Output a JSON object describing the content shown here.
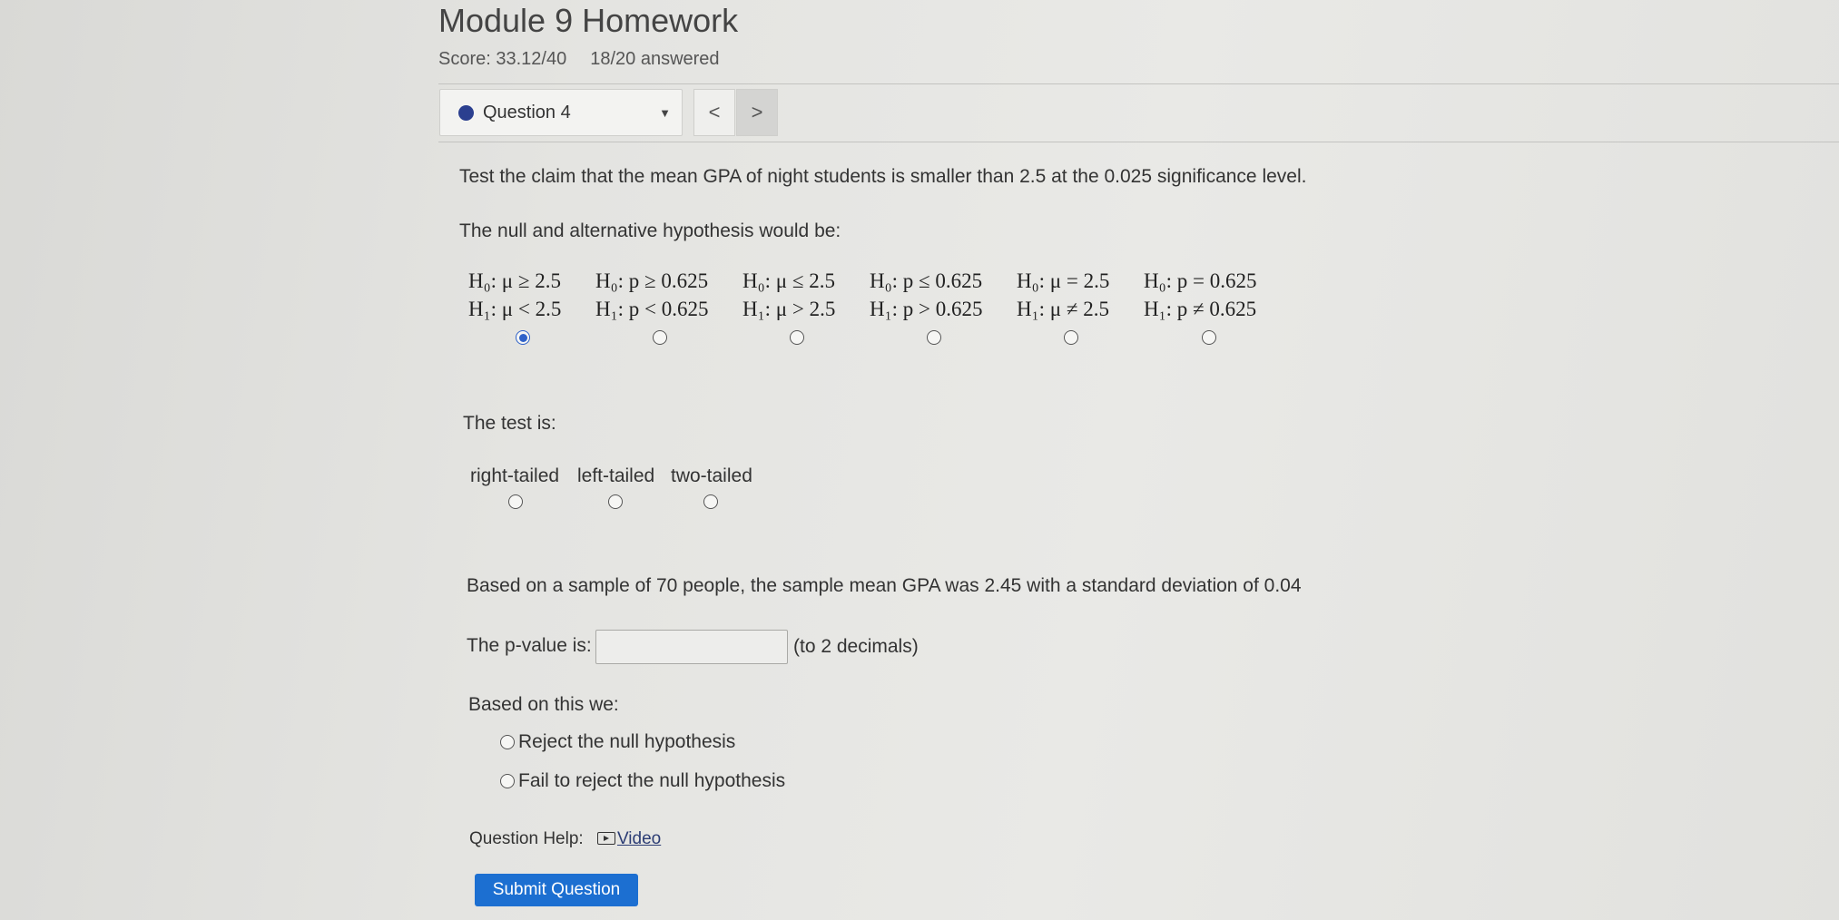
{
  "header": {
    "title": "Module 9 Homework",
    "score": "Score: 33.12/40",
    "answered": "18/20 answered"
  },
  "nav": {
    "question_select": "Question 4",
    "prev_icon": "chevron-left-icon",
    "next_icon": "chevron-right-icon",
    "prev_glyph": "<",
    "next_glyph": ">"
  },
  "question": {
    "prompt": "Test the claim that the mean GPA of night students is smaller than 2.5 at the 0.025 significance level.",
    "hypothesis_label": "The null and alternative hypothesis would be:",
    "hypotheses": [
      {
        "h0": "H₀: μ ≥ 2.5",
        "h1": "H₁: μ < 2.5",
        "selected": true
      },
      {
        "h0": "H₀: p ≥ 0.625",
        "h1": "H₁: p < 0.625",
        "selected": false
      },
      {
        "h0": "H₀: μ ≤ 2.5",
        "h1": "H₁: μ > 2.5",
        "selected": false
      },
      {
        "h0": "H₀: p ≤ 0.625",
        "h1": "H₁: p > 0.625",
        "selected": false
      },
      {
        "h0": "H₀: μ = 2.5",
        "h1": "H₁: μ ≠ 2.5",
        "selected": false
      },
      {
        "h0": "H₀: p = 0.625",
        "h1": "H₁: p ≠ 0.625",
        "selected": false
      }
    ],
    "test_label": "The test is:",
    "test_options": [
      {
        "label": "right-tailed",
        "selected": false
      },
      {
        "label": "left-tailed",
        "selected": false
      },
      {
        "label": "two-tailed",
        "selected": false
      }
    ],
    "sample_text": "Based on a sample of 70 people, the sample mean GPA was 2.45 with a standard deviation of 0.04",
    "pvalue_label": "The p-value is:",
    "pvalue_value": "",
    "pvalue_hint": "(to 2 decimals)",
    "decision_label": "Based on this we:",
    "decisions": [
      {
        "label": "Reject the null hypothesis",
        "selected": false
      },
      {
        "label": "Fail to reject the null hypothesis",
        "selected": false
      }
    ],
    "help_label": "Question Help:",
    "video_label": "Video",
    "submit_label": "Submit Question"
  },
  "colors": {
    "accent": "#1c6fd1",
    "radio_selected": "#2f62c9",
    "question_dot": "#2b3f8f"
  }
}
